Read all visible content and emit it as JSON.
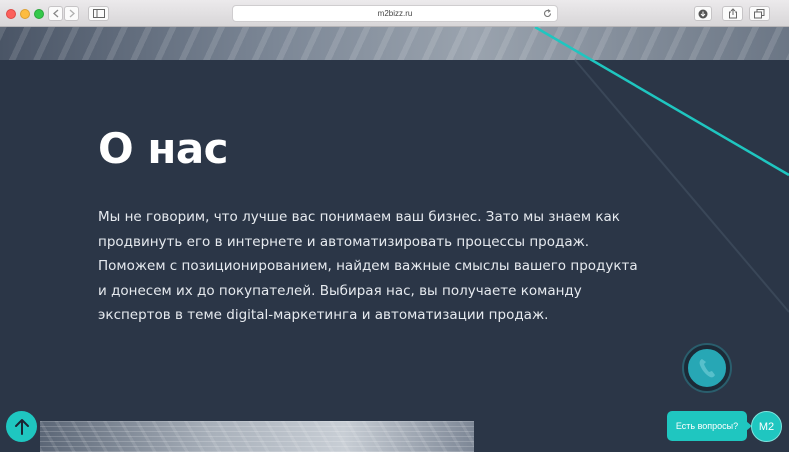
{
  "browser": {
    "url": "m2bizz.ru",
    "new_tab_label": "+"
  },
  "page": {
    "heading": "О нас",
    "paragraph_lines": [
      "Мы не говорим, что лучше вас понимаем ваш бизнес. Зато мы знаем как",
      "продвинуть его в интернете и автоматизировать процессы продаж.",
      "Поможем с позиционированием, найдем важные смыслы вашего продукта",
      "и донесем их до покупателей. Выбирая нас, вы получаете команду",
      "экспертов в теме digital-маркетинга и автоматизации продаж."
    ]
  },
  "widgets": {
    "chat_prompt": "Есть вопросы?",
    "chat_avatar_label": "M2"
  },
  "colors": {
    "background": "#2b3647",
    "accent": "#1fc6c0",
    "text": "#ffffff"
  },
  "icons": {
    "scroll_up": "arrow-up-icon",
    "call": "phone-icon",
    "reload": "reload-icon"
  }
}
